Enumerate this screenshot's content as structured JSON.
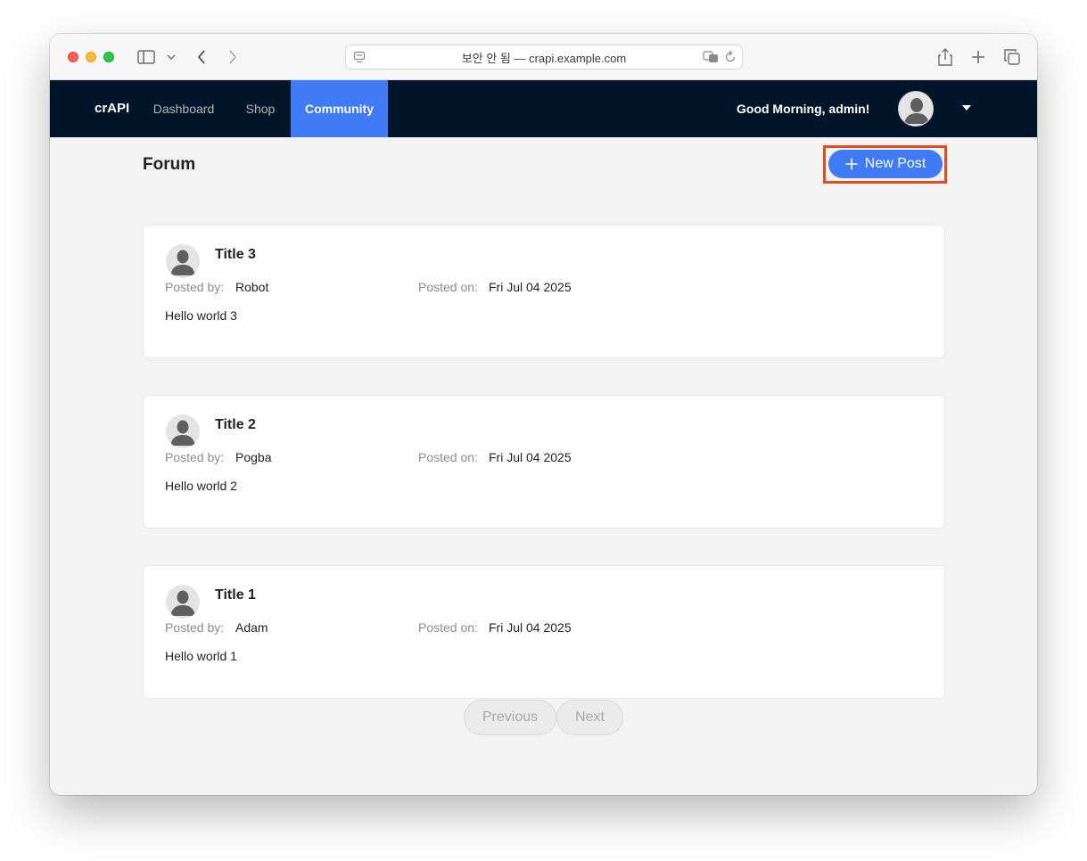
{
  "browser": {
    "address_text": "보안 안 됨 — crapi.example.com"
  },
  "navbar": {
    "brand": "crAPI",
    "items": [
      {
        "label": "Dashboard"
      },
      {
        "label": "Shop"
      },
      {
        "label": "Community",
        "active": true
      }
    ],
    "greeting": "Good Morning, admin!"
  },
  "forum": {
    "title": "Forum",
    "new_post_label": "New Post",
    "posted_by_label": "Posted by:",
    "posted_on_label": "Posted on:",
    "posts": [
      {
        "title": "Title 3",
        "author": "Robot",
        "date": "Fri Jul 04 2025",
        "body": "Hello world 3"
      },
      {
        "title": "Title 2",
        "author": "Pogba",
        "date": "Fri Jul 04 2025",
        "body": "Hello world 2"
      },
      {
        "title": "Title 1",
        "author": "Adam",
        "date": "Fri Jul 04 2025",
        "body": "Hello world 1"
      }
    ]
  },
  "pagination": {
    "previous_label": "Previous",
    "next_label": "Next"
  },
  "colors": {
    "navbar_bg": "#001529",
    "accent": "#3f7bf6",
    "highlight": "#e8471f"
  }
}
